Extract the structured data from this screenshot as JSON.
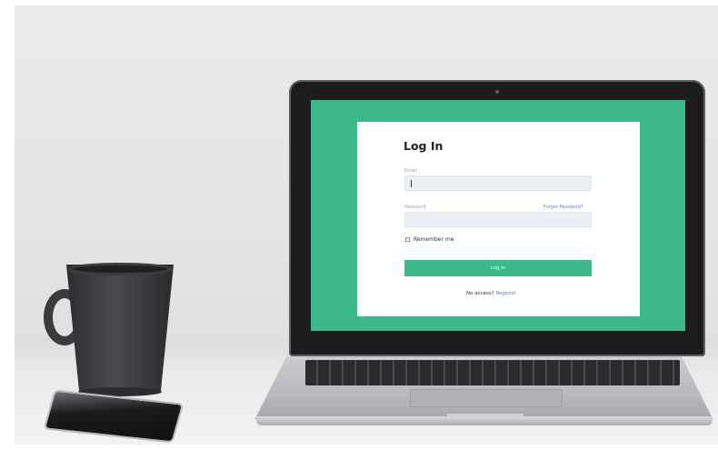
{
  "login": {
    "title": "Log In",
    "email_label": "Email",
    "email_value": "",
    "password_label": "Password",
    "password_value": "",
    "forgot_password": "Forgot Password?",
    "remember_me": "Remember me",
    "remember_checked": false,
    "login_button": "Log In",
    "no_access": "No access?",
    "register_link": "Register"
  },
  "colors": {
    "brand_green": "#3db88b",
    "link_blue": "#6b7fb7"
  }
}
